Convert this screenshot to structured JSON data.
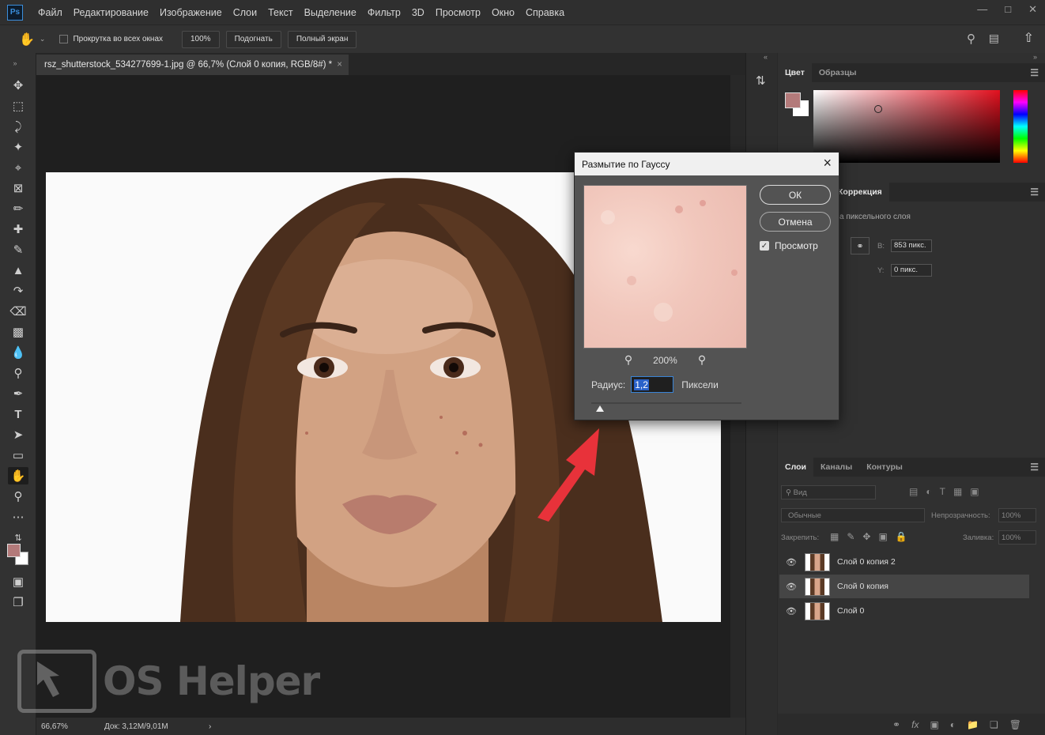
{
  "app": {
    "logo": "Ps",
    "menu": [
      "Файл",
      "Редактирование",
      "Изображение",
      "Слои",
      "Текст",
      "Выделение",
      "Фильтр",
      "3D",
      "Просмотр",
      "Окно",
      "Справка"
    ],
    "window_controls": [
      "minimize-icon",
      "maximize-icon",
      "close-icon"
    ]
  },
  "options_bar": {
    "scroll_all_label": "Прокрутка во всех окнах",
    "zoom_100": "100%",
    "fit_label": "Подогнать",
    "fullscreen_label": "Полный экран"
  },
  "document": {
    "tab_title": "rsz_shutterstock_534277699-1.jpg @ 66,7% (Слой 0 копия, RGB/8#) *",
    "tab_close": "×"
  },
  "status": {
    "zoom": "66,67%",
    "doc_info": "Док: 3,12M/9,01M",
    "arrow": "›"
  },
  "color_panel": {
    "tabs": [
      "Цвет",
      "Образцы"
    ],
    "foreground": "#b37a7a",
    "background": "#ffffff"
  },
  "properties_panel": {
    "tab_label": "Коррекция",
    "subtitle": "а пиксельного слоя",
    "w_label": "В:",
    "w_value": "853 пикс.",
    "y_label": "Y:",
    "y_value": "0 пикс."
  },
  "layers_panel": {
    "tabs": [
      "Слои",
      "Каналы",
      "Контуры"
    ],
    "filter_placeholder": "Вид",
    "blend_mode": "Обычные",
    "opacity_label": "Непрозрачность:",
    "opacity_value": "100%",
    "lock_label": "Закрепить:",
    "fill_label": "Заливка:",
    "fill_value": "100%",
    "layers": [
      {
        "name": "Слой 0 копия 2",
        "selected": false
      },
      {
        "name": "Слой 0 копия",
        "selected": true
      },
      {
        "name": "Слой 0",
        "selected": false
      }
    ]
  },
  "dialog": {
    "title": "Размытие по Гауссу",
    "ok_label": "ОК",
    "cancel_label": "Отмена",
    "preview_label": "Просмотр",
    "preview_checked": true,
    "zoom_value": "200%",
    "radius_label": "Радиус:",
    "radius_value": "1,2",
    "radius_unit": "Пиксели"
  },
  "watermark": {
    "text": "OS Helper"
  }
}
